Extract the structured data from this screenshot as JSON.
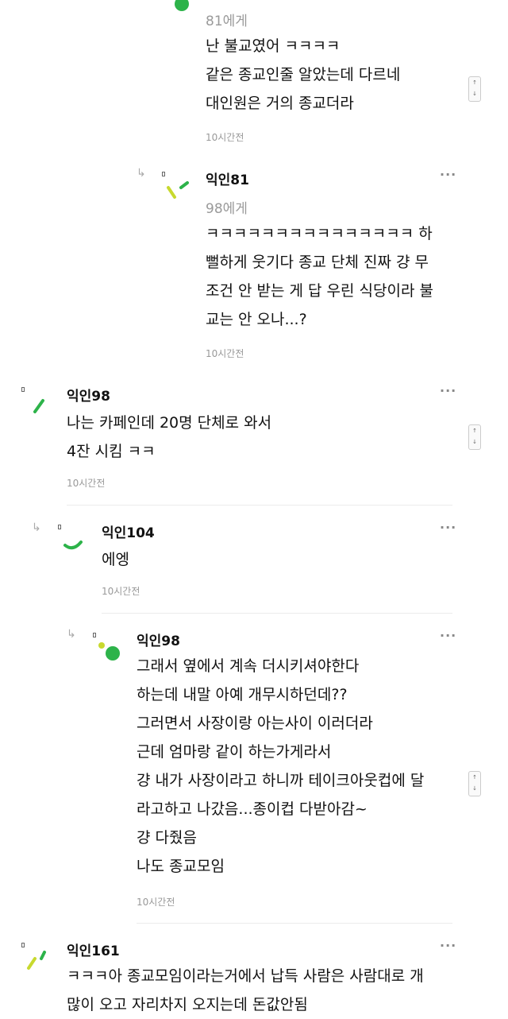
{
  "comments": [
    {
      "mention": "81에게",
      "lines": [
        "난 불교였어 ㅋㅋㅋㅋ",
        "같은 종교인줄 알았는데 다르네",
        "대인원은 거의 종교더라"
      ],
      "time": "10시간전"
    },
    {
      "author": "익인81",
      "mention": "98에게",
      "lines": [
        "ㅋㅋㅋㅋㅋㅋㅋㅋㅋㅋㅋㅋㅋㅋㅋ 하",
        "뻘하게 웃기다 종교 단체 진짜 걍 무",
        "조건 안 받는 게 답 우린 식당이라 불",
        "교는 안 오나...?"
      ],
      "time": "10시간전"
    },
    {
      "author": "익인98",
      "lines": [
        "나는 카페인데 20명 단체로 와서",
        "4잔 시킴 ㅋㅋ"
      ],
      "time": "10시간전"
    },
    {
      "author": "익인104",
      "lines": [
        "에엥"
      ],
      "time": "10시간전"
    },
    {
      "author": "익인98",
      "lines": [
        "그래서 옆에서 계속 더시키셔야한다",
        "하는데 내말 아예 개무시하던데??",
        "그러면서 사장이랑 아는사이 이러더라",
        "근데 엄마랑 같이 하는가게라서",
        "걍 내가 사장이라고 하니까 테이크아웃컵에 달",
        "라고하고 나갔음...종이컵 다받아감~",
        "걍 다줬음",
        "나도 종교모임"
      ],
      "time": "10시간전"
    },
    {
      "author": "익인161",
      "lines": [
        "ㅋㅋㅋ아 종교모임이라는거에서 납득 사람은 사람대로 개",
        "많이 오고 자리차지 오지는데 돈값안됨"
      ]
    }
  ],
  "ui": {
    "more": "···",
    "reply_icon": "↳",
    "scroll_up": "↑",
    "scroll_down": "↓"
  },
  "colors": {
    "green": "#2db34a",
    "lime": "#c8d92e",
    "text": "#111111",
    "muted": "#999999"
  }
}
